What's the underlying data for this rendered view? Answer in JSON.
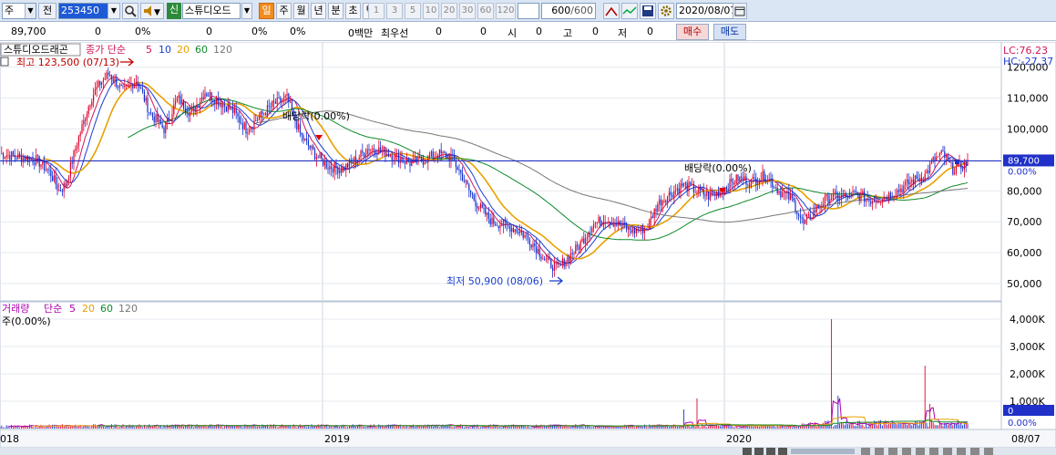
{
  "toolbar": {
    "market_select": "주",
    "prev_label": "전",
    "code_value": "253450",
    "sound_icon_label": "◀",
    "credit_badge": "신",
    "stock_name": "스튜디오드",
    "periods": [
      "일",
      "주",
      "월",
      "년",
      "분",
      "초",
      "틱"
    ],
    "active_period": "일",
    "intervals": [
      "1",
      "3",
      "5",
      "10",
      "20",
      "30",
      "60",
      "120"
    ],
    "count_value": "600",
    "count_total": "/600",
    "date_value": "2020/08/07"
  },
  "quote": {
    "price": "89,700",
    "change": "0",
    "change_rate": "0%",
    "volume": "0",
    "volume_rate": "0%",
    "volume_rate2": "0%",
    "amount": "0백만",
    "best_ask_label": "최우선",
    "best_ask": "0",
    "best_bid": "0",
    "open_label": "시",
    "open": "0",
    "high_label": "고",
    "high": "0",
    "low_label": "저",
    "low": "0",
    "buy_label": "매수",
    "sell_label": "매도"
  },
  "price_panel": {
    "title": "스튜디오드래곤",
    "ma_label": "종가 단순",
    "ma_periods": [
      "5",
      "10",
      "20",
      "60",
      "120"
    ],
    "ma_colors": [
      "#d0155a",
      "#1a3fd0",
      "#e8a000",
      "#0f8a2a",
      "#777777"
    ],
    "lc_label": "LC:76.23",
    "hc_label": "HC:-27.37",
    "high_annotation": "최고 123,500 (07/13)",
    "low_annotation": "최저 50,900 (08/06)",
    "dividend_1": "배당락(0.00%)",
    "dividend_2": "배당락(0.00%)",
    "ref_line_label": "89,700",
    "ref_line_pct": "0.00%",
    "y_ticks": [
      "120,000",
      "110,000",
      "100,000",
      "90,000",
      "80,000",
      "70,000",
      "60,000",
      "50,000"
    ]
  },
  "volume_panel": {
    "title": "거래량",
    "ma_label": "단순",
    "ma_periods": [
      "5",
      "20",
      "60",
      "120"
    ],
    "ma_colors": [
      "#b000b0",
      "#e8a000",
      "#0f8a2a",
      "#777777"
    ],
    "unit_label": "주(0.00%)",
    "y_ticks": [
      "4,000K",
      "3,000K",
      "2,000K",
      "1,000K"
    ],
    "current_label": "0",
    "current_pct": "0.00%"
  },
  "x_axis": {
    "labels": [
      "018",
      "2019",
      "2020",
      "08/07"
    ]
  },
  "chart_data": {
    "type": "line",
    "title": "스튜디오드래곤",
    "ylim": [
      45000,
      127000
    ],
    "series": [
      {
        "name": "종가",
        "points": [
          [
            0,
            92000
          ],
          [
            20,
            91000
          ],
          [
            40,
            90000
          ],
          [
            55,
            86000
          ],
          [
            65,
            80000
          ],
          [
            72,
            82000
          ],
          [
            85,
            96000
          ],
          [
            100,
            110000
          ],
          [
            110,
            115000
          ],
          [
            120,
            118000
          ],
          [
            135,
            112000
          ],
          [
            150,
            116000
          ],
          [
            165,
            105000
          ],
          [
            180,
            100000
          ],
          [
            195,
            110000
          ],
          [
            210,
            105000
          ],
          [
            225,
            112000
          ],
          [
            240,
            109000
          ],
          [
            255,
            106000
          ],
          [
            270,
            100000
          ],
          [
            285,
            104000
          ],
          [
            300,
            108000
          ],
          [
            315,
            110000
          ],
          [
            330,
            98000
          ],
          [
            345,
            92000
          ],
          [
            360,
            88000
          ],
          [
            375,
            87000
          ],
          [
            390,
            90000
          ],
          [
            405,
            94000
          ],
          [
            420,
            93000
          ],
          [
            435,
            91000
          ],
          [
            450,
            89000
          ],
          [
            465,
            90000
          ],
          [
            480,
            92000
          ],
          [
            495,
            91000
          ],
          [
            505,
            86000
          ],
          [
            515,
            80000
          ],
          [
            525,
            75000
          ],
          [
            540,
            70000
          ],
          [
            555,
            69000
          ],
          [
            570,
            67000
          ],
          [
            585,
            63000
          ],
          [
            600,
            57000
          ],
          [
            612,
            55000
          ],
          [
            622,
            58000
          ],
          [
            635,
            62000
          ],
          [
            650,
            69000
          ],
          [
            665,
            71000
          ],
          [
            680,
            69000
          ],
          [
            695,
            67000
          ],
          [
            710,
            68000
          ],
          [
            722,
            76000
          ],
          [
            735,
            79000
          ],
          [
            750,
            82000
          ],
          [
            765,
            80000
          ],
          [
            780,
            78000
          ],
          [
            795,
            81000
          ],
          [
            810,
            84000
          ],
          [
            825,
            83000
          ],
          [
            840,
            85000
          ],
          [
            855,
            80000
          ],
          [
            870,
            77000
          ],
          [
            882,
            69000
          ],
          [
            895,
            74000
          ],
          [
            910,
            78000
          ],
          [
            925,
            78000
          ],
          [
            940,
            79000
          ],
          [
            955,
            77000
          ],
          [
            970,
            78000
          ],
          [
            985,
            80000
          ],
          [
            1000,
            83000
          ],
          [
            1015,
            85000
          ],
          [
            1025,
            90000
          ],
          [
            1035,
            92000
          ],
          [
            1045,
            87000
          ],
          [
            1055,
            88000
          ],
          [
            1063,
            89700
          ]
        ]
      }
    ],
    "dividend_markers": [
      {
        "x": 350
      },
      {
        "x": 793
      }
    ],
    "volume_spikes": [
      {
        "x": 750,
        "value": 700
      },
      {
        "x": 765,
        "value": 1100
      },
      {
        "x": 913,
        "value": 4000
      },
      {
        "x": 920,
        "value": 1200
      },
      {
        "x": 1015,
        "value": 2300
      },
      {
        "x": 1020,
        "value": 900
      }
    ]
  }
}
